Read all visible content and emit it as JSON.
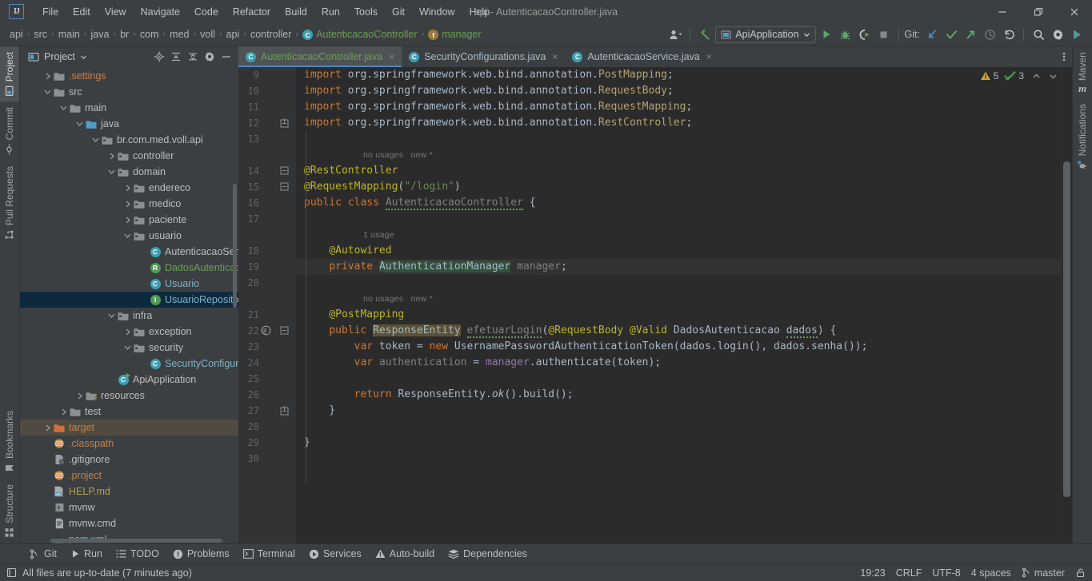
{
  "titlebar": {
    "logo": "IJ",
    "window_title": "api - AutenticacaoController.java",
    "menus": [
      "File",
      "Edit",
      "View",
      "Navigate",
      "Code",
      "Refactor",
      "Build",
      "Run",
      "Tools",
      "Git",
      "Window",
      "Help"
    ],
    "controls": {
      "minimize": "minimize-icon",
      "restore": "restore-icon",
      "close": "close-icon"
    }
  },
  "navbar": {
    "breadcrumbs": [
      {
        "label": "api",
        "icon": null,
        "style": "plain"
      },
      {
        "label": "src",
        "icon": null,
        "style": "plain"
      },
      {
        "label": "main",
        "icon": null,
        "style": "plain"
      },
      {
        "label": "java",
        "icon": null,
        "style": "plain"
      },
      {
        "label": "br",
        "icon": null,
        "style": "plain"
      },
      {
        "label": "com",
        "icon": null,
        "style": "plain"
      },
      {
        "label": "med",
        "icon": null,
        "style": "plain"
      },
      {
        "label": "voll",
        "icon": null,
        "style": "plain"
      },
      {
        "label": "api",
        "icon": null,
        "style": "plain"
      },
      {
        "label": "controller",
        "icon": null,
        "style": "plain"
      },
      {
        "label": "AutenticacaoController",
        "icon": "C",
        "style": "green"
      },
      {
        "label": "manager",
        "icon": "f",
        "style": "green"
      }
    ],
    "separator": "›",
    "toolbar": {
      "account_icon": "user-icon",
      "back_icon": "back-arrow-icon",
      "run_config": "ApiApplication",
      "run_icon": "run-icon",
      "debug_icon": "debug-icon",
      "coverage_icon": "coverage-icon",
      "stop_icon": "stop-icon",
      "git_label": "Git:",
      "update_project_icon": "update-project-icon",
      "commit_icon": "commit-checkmark-icon",
      "push_icon": "push-icon",
      "history_icon": "history-icon",
      "rollback_icon": "rollback-icon",
      "search_icon": "search-icon",
      "settings_icon": "gear-icon",
      "updates_icon": "ide-update-icon"
    }
  },
  "left_strip": {
    "tabs": [
      {
        "label": "Project",
        "icon": "project-icon",
        "active": true
      },
      {
        "label": "Commit",
        "icon": "commit-icon",
        "active": false
      },
      {
        "label": "Pull Requests",
        "icon": "pull-request-icon",
        "active": false
      }
    ],
    "bottom_tabs": [
      {
        "label": "Bookmarks",
        "icon": "bookmark-icon",
        "active": false
      },
      {
        "label": "Structure",
        "icon": "structure-icon",
        "active": false
      }
    ]
  },
  "right_strip": {
    "tabs": [
      {
        "label": "Maven",
        "icon": "maven-icon"
      },
      {
        "label": "Notifications",
        "icon": "notifications-bell-icon"
      }
    ]
  },
  "project_panel": {
    "title": "Project",
    "dropdown_icon": "chevron-down-icon",
    "actions": [
      "locate-icon",
      "expand-all-icon",
      "collapse-all-icon",
      "gear-icon",
      "hide-icon"
    ],
    "tree": [
      {
        "indent": 1,
        "arrow": "right",
        "icon": "folder",
        "label": ".settings",
        "color": "orange"
      },
      {
        "indent": 1,
        "arrow": "down",
        "icon": "folder",
        "label": "src",
        "color": "plain"
      },
      {
        "indent": 2,
        "arrow": "down",
        "icon": "folder",
        "label": "main",
        "color": "plain"
      },
      {
        "indent": 3,
        "arrow": "down",
        "icon": "folder-src",
        "label": "java",
        "color": "plain"
      },
      {
        "indent": 4,
        "arrow": "down",
        "icon": "package",
        "label": "br.com.med.voll.api",
        "color": "plain"
      },
      {
        "indent": 5,
        "arrow": "right",
        "icon": "package",
        "label": "controller",
        "color": "plain"
      },
      {
        "indent": 5,
        "arrow": "down",
        "icon": "package",
        "label": "domain",
        "color": "plain"
      },
      {
        "indent": 6,
        "arrow": "right",
        "icon": "package",
        "label": "endereco",
        "color": "plain"
      },
      {
        "indent": 6,
        "arrow": "right",
        "icon": "package",
        "label": "medico",
        "color": "plain"
      },
      {
        "indent": 6,
        "arrow": "right",
        "icon": "package",
        "label": "paciente",
        "color": "plain"
      },
      {
        "indent": 6,
        "arrow": "down",
        "icon": "package",
        "label": "usuario",
        "color": "plain"
      },
      {
        "indent": 7,
        "arrow": "none",
        "icon": "class",
        "label": "AutenticacaoService",
        "color": "plain"
      },
      {
        "indent": 7,
        "arrow": "none",
        "icon": "record",
        "label": "DadosAutenticacao",
        "color": "green"
      },
      {
        "indent": 7,
        "arrow": "none",
        "icon": "class",
        "label": "Usuario",
        "color": "blue"
      },
      {
        "indent": 7,
        "arrow": "none",
        "icon": "interface",
        "label": "UsuarioRepository",
        "color": "blue",
        "selected": true
      },
      {
        "indent": 5,
        "arrow": "down",
        "icon": "package",
        "label": "infra",
        "color": "plain"
      },
      {
        "indent": 6,
        "arrow": "right",
        "icon": "package",
        "label": "exception",
        "color": "plain"
      },
      {
        "indent": 6,
        "arrow": "down",
        "icon": "package",
        "label": "security",
        "color": "plain"
      },
      {
        "indent": 7,
        "arrow": "none",
        "icon": "class",
        "label": "SecurityConfigurations",
        "color": "blue"
      },
      {
        "indent": 5,
        "arrow": "none",
        "icon": "class-run",
        "label": "ApiApplication",
        "color": "plain"
      },
      {
        "indent": 3,
        "arrow": "right",
        "icon": "folder-res",
        "label": "resources",
        "color": "plain"
      },
      {
        "indent": 2,
        "arrow": "right",
        "icon": "folder",
        "label": "test",
        "color": "plain"
      },
      {
        "indent": 1,
        "arrow": "right",
        "icon": "folder-target",
        "label": "target",
        "color": "orange",
        "highlight": true
      },
      {
        "indent": 1,
        "arrow": "none",
        "icon": "file-xml",
        "label": ".classpath",
        "color": "orange"
      },
      {
        "indent": 1,
        "arrow": "none",
        "icon": "file-gitignore",
        "label": ".gitignore",
        "color": "plain"
      },
      {
        "indent": 1,
        "arrow": "none",
        "icon": "file-xml",
        "label": ".project",
        "color": "orange"
      },
      {
        "indent": 1,
        "arrow": "none",
        "icon": "file-md",
        "label": "HELP.md",
        "color": "yellow"
      },
      {
        "indent": 1,
        "arrow": "none",
        "icon": "file-sh",
        "label": "mvnw",
        "color": "plain"
      },
      {
        "indent": 1,
        "arrow": "none",
        "icon": "file-cmd",
        "label": "mvnw.cmd",
        "color": "plain"
      },
      {
        "indent": 1,
        "arrow": "none",
        "icon": "file-maven",
        "label": "pom.xml",
        "color": "blue"
      }
    ]
  },
  "editor": {
    "tabs": [
      {
        "label": "AutenticacaoController.java",
        "icon": "C",
        "active": true,
        "close": "×"
      },
      {
        "label": "SecurityConfigurations.java",
        "icon": "C",
        "active": false,
        "close": "×"
      },
      {
        "label": "AutenticacaoService.java",
        "icon": "C",
        "active": false,
        "close": "×"
      }
    ],
    "more_icon": "more-options-icon",
    "inspections": {
      "warning_icon": "warning-triangle-icon",
      "warning_count": "5",
      "weak_warning_icon": "weak-warning-icon",
      "weak_warning_count": "3",
      "prev_icon": "chevron-up-icon",
      "next_icon": "chevron-down-icon"
    },
    "line_numbers": [
      "9",
      "10",
      "11",
      "12",
      "13",
      "14",
      "15",
      "16",
      "17",
      "18",
      "19",
      "20",
      "21",
      "22",
      "23",
      "24",
      "25",
      "26",
      "27",
      "28",
      "29",
      "30"
    ],
    "hints": [
      {
        "line": 13,
        "text": "no usages   new *"
      },
      {
        "line": 17,
        "text": "1 usage"
      },
      {
        "line": 20,
        "text": "no usages   new *"
      }
    ],
    "code_lines": [
      "import org.springframework.web.bind.annotation.PostMapping;",
      "import org.springframework.web.bind.annotation.RequestBody;",
      "import org.springframework.web.bind.annotation.RequestMapping;",
      "import org.springframework.web.bind.annotation.RestController;",
      "",
      "@RestController",
      "@RequestMapping(\"/login\")",
      "public class AutenticacaoController {",
      "",
      "    @Autowired",
      "    private AuthenticationManager manager;",
      "",
      "    @PostMapping",
      "    public ResponseEntity efetuarLogin(@RequestBody @Valid DadosAutenticacao dados) {",
      "        var token = new UsernamePasswordAuthenticationToken(dados.login(), dados.senha());",
      "        var authentication = manager.authenticate(token);",
      "",
      "        return ResponseEntity.ok().build();",
      "    }",
      "",
      "}",
      ""
    ],
    "gutter_at_icon": "override-annotation-icon"
  },
  "tool_window_bar": {
    "items": [
      {
        "label": "Git",
        "icon": "git-branch-icon"
      },
      {
        "label": "Run",
        "icon": "run-icon"
      },
      {
        "label": "TODO",
        "icon": "todo-icon"
      },
      {
        "label": "Problems",
        "icon": "problems-icon"
      },
      {
        "label": "Terminal",
        "icon": "terminal-icon"
      },
      {
        "label": "Services",
        "icon": "services-icon"
      },
      {
        "label": "Auto-build",
        "icon": "auto-build-icon"
      },
      {
        "label": "Dependencies",
        "icon": "dependencies-icon"
      }
    ]
  },
  "status_bar": {
    "message_icon": "status-file-icon",
    "message": "All files are up-to-date (7 minutes ago)",
    "caret_position": "19:23",
    "line_separator": "CRLF",
    "encoding": "UTF-8",
    "indent": "4 spaces",
    "branch_icon": "git-branch-icon",
    "branch": "master",
    "lock_icon": "read-only-lock-icon"
  },
  "colors": {
    "bg_panel": "#3c3f41",
    "bg_editor": "#2b2b2b",
    "accent_blue": "#4a88c7",
    "selection": "#0d293e",
    "green_text": "#6a9e58",
    "warning": "#d0a23b"
  }
}
